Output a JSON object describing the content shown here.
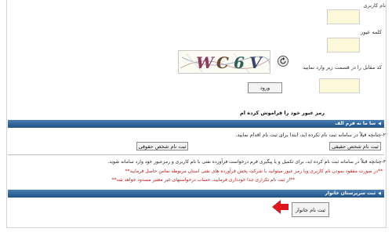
{
  "login": {
    "username_label": "نام کاربری",
    "password_label": "کلمه عبور",
    "captcha_label": "کد مقابل را در قسمت زیر وارد نمایید",
    "captcha_text": "WC6V",
    "login_button": "ورود",
    "forgot_password": "رمز عبور خود را فراموش کرده ام"
  },
  "section_cosmetic": {
    "title": "سا ما نه فرم الف",
    "line2": "۲-چنانچه قبلاً در سامانه ثبت نام نکرده اید، ابتدا برای ثبت نام اقدام نمایید.",
    "btn_real": "ثبت نام شخص حقیقی",
    "btn_legal": "ثبت نام شخص حقوقی",
    "line3": "۳-چنانچه قبلاً در سامانه ثبت نام کرده اید، برای تکمیل و یا پیگیری فرم درخواست فرآورده نفتی با نام کاربری و رمزعبور خود وارد سامانه شوید.",
    "warn1": "**در صورت مفقود نمودن نام کاربری ویا رمز عبور میتوانید با شرکت پخش فرآورده های نفتی استان مربوطه تماس حاصل فرمایید**",
    "warn2": "**از ثبت نام تکراری جدا خودداری فرمایید. حساب درخواستهای غیر معتبر مسدود خواهد شد**"
  },
  "section_household": {
    "title": "ثبت سرپرستان خانوار",
    "btn_household": "ثبت نام خانوار"
  },
  "colors": {
    "field_bg": "#fdf9d8",
    "bar_top": "#4a7fb4",
    "bar_bottom": "#1f5287",
    "warning": "#c21818",
    "arrow": "#e0141b"
  }
}
